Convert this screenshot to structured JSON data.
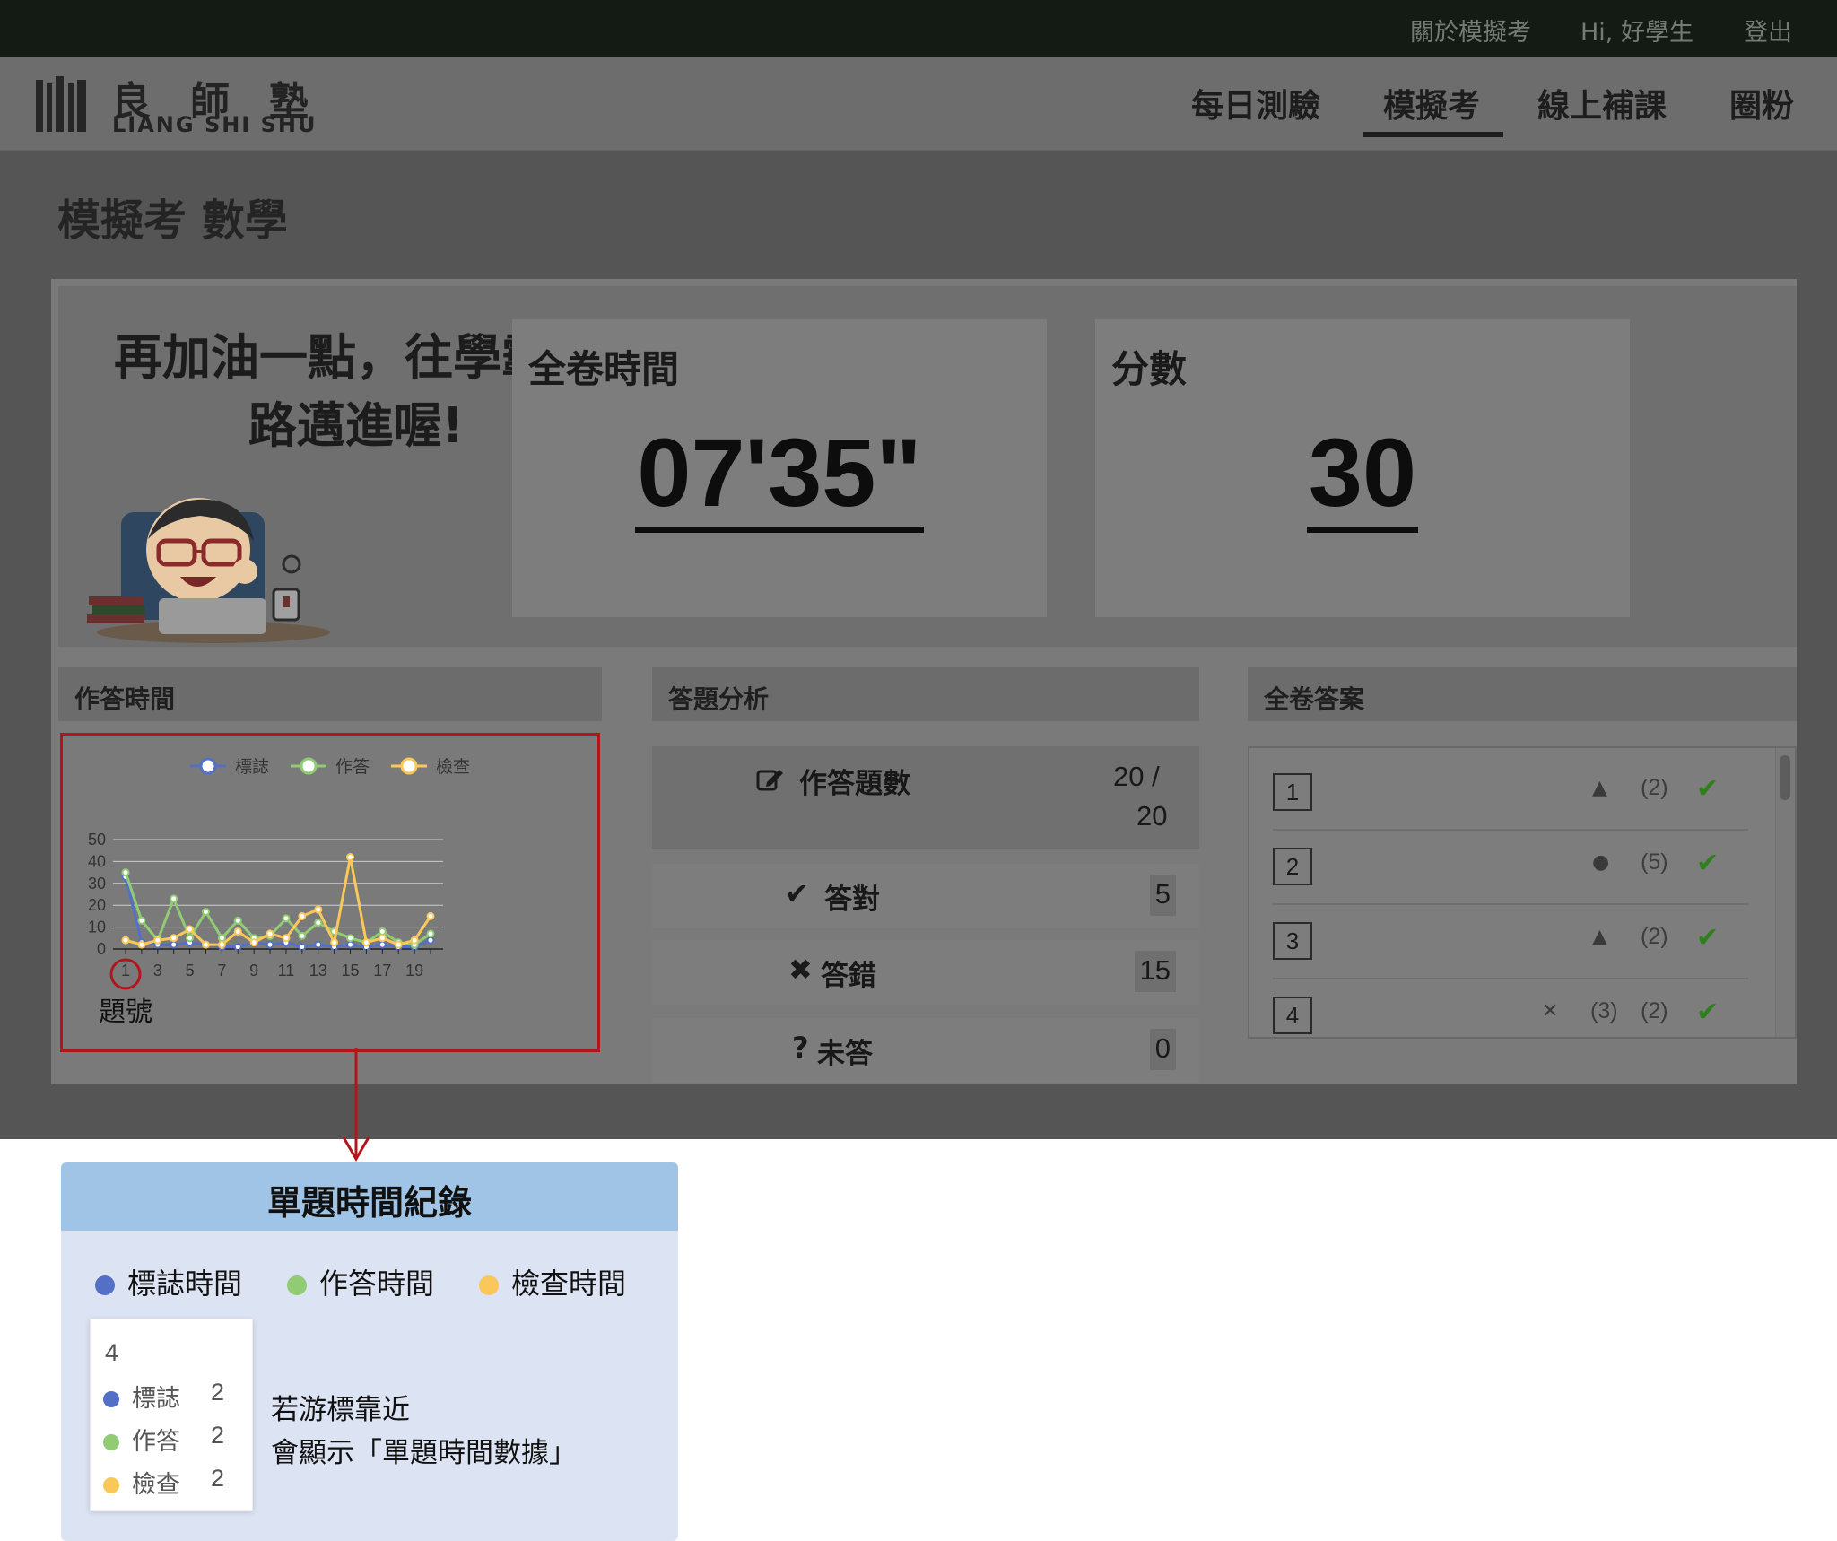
{
  "topbar": {
    "about": "關於模擬考",
    "greeting": "Hi, 好學生",
    "logout": "登出"
  },
  "logo": {
    "char1": "良",
    "char2": "師",
    "char3": "塾",
    "latin": "LIANG SHI SHU"
  },
  "nav": {
    "items": [
      {
        "label": "每日測驗"
      },
      {
        "label": "模擬考",
        "active": true
      },
      {
        "label": "線上補課"
      },
      {
        "label": "圈粉"
      }
    ]
  },
  "page": {
    "title": "模擬考 數學"
  },
  "hero": {
    "encourage_line1": "再加油一點，往學霸之",
    "encourage_line2": "路邁進喔!",
    "time_label": "全卷時間",
    "time_value": "07'35\"",
    "score_label": "分數",
    "score_value": "30"
  },
  "sections": {
    "time": "作答時間",
    "analysis": "答題分析",
    "answers": "全卷答案"
  },
  "analysis": {
    "answered_label": "作答題數",
    "answered_value": "20 /",
    "answered_total": "20",
    "correct_label": "答對",
    "correct_value": "5",
    "wrong_label": "答錯",
    "wrong_value": "15",
    "blank_label": "未答",
    "blank_value": "0"
  },
  "answers": [
    {
      "num": "1",
      "mark": "triangle-icon",
      "extra": "",
      "val": "(2)"
    },
    {
      "num": "2",
      "mark": "dot-icon",
      "extra": "",
      "val": "(5)"
    },
    {
      "num": "3",
      "mark": "triangle-icon",
      "extra": "",
      "val": "(2)"
    },
    {
      "num": "4",
      "mark": "cross-icon",
      "extra": "(3)",
      "val": "(2)"
    }
  ],
  "chart_data": {
    "type": "line",
    "xlabel": "題號",
    "x": [
      1,
      2,
      3,
      4,
      5,
      6,
      7,
      8,
      9,
      10,
      11,
      12,
      13,
      14,
      15,
      16,
      17,
      18,
      19,
      20
    ],
    "x_tick_labels": [
      "1",
      "3",
      "5",
      "7",
      "9",
      "11",
      "13",
      "15",
      "17",
      "19"
    ],
    "ylim": [
      0,
      50
    ],
    "y_ticks": [
      "0",
      "10",
      "20",
      "30",
      "40",
      "50"
    ],
    "grid": true,
    "legend_position": "top",
    "series": [
      {
        "name": "標誌",
        "color": "#5470c6",
        "values": [
          33,
          3,
          2,
          2,
          3,
          2,
          1,
          1,
          3,
          2,
          3,
          1,
          2,
          1,
          2,
          1,
          2,
          1,
          1,
          4
        ]
      },
      {
        "name": "作答",
        "color": "#91cc75",
        "values": [
          35,
          13,
          4,
          23,
          5,
          17,
          5,
          13,
          5,
          6,
          14,
          6,
          12,
          8,
          5,
          3,
          8,
          3,
          2,
          7
        ]
      },
      {
        "name": "檢查",
        "color": "#fac858",
        "values": [
          4,
          2,
          4,
          5,
          9,
          2,
          2,
          8,
          3,
          7,
          5,
          15,
          18,
          3,
          42,
          3,
          5,
          2,
          4,
          15
        ]
      }
    ]
  },
  "note": {
    "title": "單題時間紀錄",
    "legend": [
      {
        "label": "標誌時間",
        "color": "#5470c6"
      },
      {
        "label": "作答時間",
        "color": "#91cc75"
      },
      {
        "label": "檢查時間",
        "color": "#fac858"
      }
    ],
    "tooltip": {
      "title": "4",
      "rows": [
        {
          "label": "標誌",
          "value": "2",
          "color": "#5470c6"
        },
        {
          "label": "作答",
          "value": "2",
          "color": "#91cc75"
        },
        {
          "label": "檢查",
          "value": "2",
          "color": "#fac858"
        }
      ]
    },
    "text_line1": "若游標靠近",
    "text_line2": "會顯示「單題時間數據」"
  }
}
